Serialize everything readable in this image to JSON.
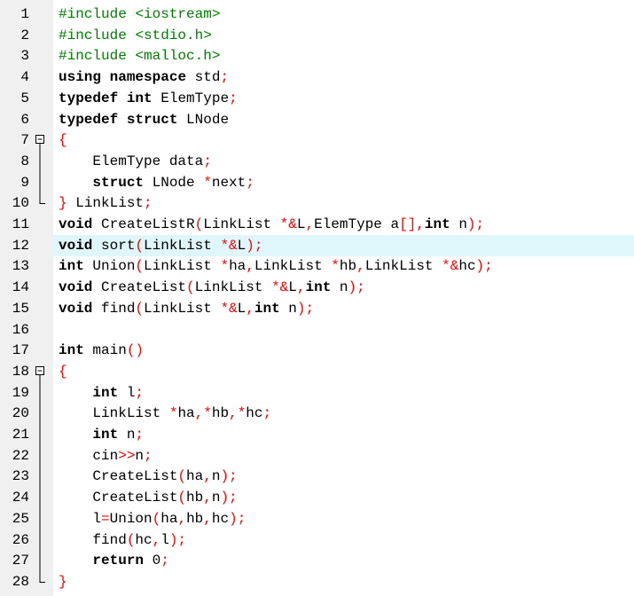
{
  "editor": {
    "highlighted_line": 12,
    "lines": [
      {
        "n": "1",
        "fold": "",
        "tokens": [
          [
            "pp",
            "#include <iostream>"
          ]
        ]
      },
      {
        "n": "2",
        "fold": "",
        "tokens": [
          [
            "pp",
            "#include <stdio.h>"
          ]
        ]
      },
      {
        "n": "3",
        "fold": "",
        "tokens": [
          [
            "pp",
            "#include <malloc.h>"
          ]
        ]
      },
      {
        "n": "4",
        "fold": "",
        "tokens": [
          [
            "kw",
            "using"
          ],
          [
            "txt",
            " "
          ],
          [
            "kw",
            "namespace"
          ],
          [
            "txt",
            " std"
          ],
          [
            "op",
            ";"
          ]
        ]
      },
      {
        "n": "5",
        "fold": "",
        "tokens": [
          [
            "kw",
            "typedef"
          ],
          [
            "txt",
            " "
          ],
          [
            "kw",
            "int"
          ],
          [
            "txt",
            " ElemType"
          ],
          [
            "op",
            ";"
          ]
        ]
      },
      {
        "n": "6",
        "fold": "",
        "tokens": [
          [
            "kw",
            "typedef"
          ],
          [
            "txt",
            " "
          ],
          [
            "kw",
            "struct"
          ],
          [
            "txt",
            " LNode"
          ]
        ]
      },
      {
        "n": "7",
        "fold": "open",
        "tokens": [
          [
            "op",
            "{"
          ]
        ]
      },
      {
        "n": "8",
        "fold": "line",
        "tokens": [
          [
            "txt",
            "    ElemType data"
          ],
          [
            "op",
            ";"
          ]
        ]
      },
      {
        "n": "9",
        "fold": "line",
        "tokens": [
          [
            "txt",
            "    "
          ],
          [
            "kw",
            "struct"
          ],
          [
            "txt",
            " LNode "
          ],
          [
            "op",
            "*"
          ],
          [
            "txt",
            "next"
          ],
          [
            "op",
            ";"
          ]
        ]
      },
      {
        "n": "10",
        "fold": "end",
        "tokens": [
          [
            "op",
            "}"
          ],
          [
            "txt",
            " LinkList"
          ],
          [
            "op",
            ";"
          ]
        ]
      },
      {
        "n": "11",
        "fold": "",
        "tokens": [
          [
            "kw",
            "void"
          ],
          [
            "txt",
            " CreateListR"
          ],
          [
            "op",
            "("
          ],
          [
            "txt",
            "LinkList "
          ],
          [
            "op",
            "*&"
          ],
          [
            "txt",
            "L"
          ],
          [
            "op",
            ","
          ],
          [
            "txt",
            "ElemType a"
          ],
          [
            "op",
            "[],"
          ],
          [
            "kw",
            "int"
          ],
          [
            "txt",
            " n"
          ],
          [
            "op",
            ");"
          ]
        ]
      },
      {
        "n": "12",
        "fold": "",
        "tokens": [
          [
            "kw",
            "void"
          ],
          [
            "txt",
            " sort"
          ],
          [
            "op",
            "("
          ],
          [
            "txt",
            "LinkList "
          ],
          [
            "op",
            "*&"
          ],
          [
            "txt",
            "L"
          ],
          [
            "op",
            ");"
          ]
        ]
      },
      {
        "n": "13",
        "fold": "",
        "tokens": [
          [
            "kw",
            "int"
          ],
          [
            "txt",
            " Union"
          ],
          [
            "op",
            "("
          ],
          [
            "txt",
            "LinkList "
          ],
          [
            "op",
            "*"
          ],
          [
            "txt",
            "ha"
          ],
          [
            "op",
            ","
          ],
          [
            "txt",
            "LinkList "
          ],
          [
            "op",
            "*"
          ],
          [
            "txt",
            "hb"
          ],
          [
            "op",
            ","
          ],
          [
            "txt",
            "LinkList "
          ],
          [
            "op",
            "*&"
          ],
          [
            "txt",
            "hc"
          ],
          [
            "op",
            ");"
          ]
        ]
      },
      {
        "n": "14",
        "fold": "",
        "tokens": [
          [
            "kw",
            "void"
          ],
          [
            "txt",
            " CreateList"
          ],
          [
            "op",
            "("
          ],
          [
            "txt",
            "LinkList "
          ],
          [
            "op",
            "*&"
          ],
          [
            "txt",
            "L"
          ],
          [
            "op",
            ","
          ],
          [
            "kw",
            "int"
          ],
          [
            "txt",
            " n"
          ],
          [
            "op",
            ");"
          ]
        ]
      },
      {
        "n": "15",
        "fold": "",
        "tokens": [
          [
            "kw",
            "void"
          ],
          [
            "txt",
            " find"
          ],
          [
            "op",
            "("
          ],
          [
            "txt",
            "LinkList "
          ],
          [
            "op",
            "*&"
          ],
          [
            "txt",
            "L"
          ],
          [
            "op",
            ","
          ],
          [
            "kw",
            "int"
          ],
          [
            "txt",
            " n"
          ],
          [
            "op",
            ");"
          ]
        ]
      },
      {
        "n": "16",
        "fold": "",
        "tokens": []
      },
      {
        "n": "17",
        "fold": "",
        "tokens": [
          [
            "kw",
            "int"
          ],
          [
            "txt",
            " main"
          ],
          [
            "op",
            "()"
          ]
        ]
      },
      {
        "n": "18",
        "fold": "open",
        "tokens": [
          [
            "op",
            "{"
          ]
        ]
      },
      {
        "n": "19",
        "fold": "line",
        "tokens": [
          [
            "txt",
            "    "
          ],
          [
            "kw",
            "int"
          ],
          [
            "txt",
            " l"
          ],
          [
            "op",
            ";"
          ]
        ]
      },
      {
        "n": "20",
        "fold": "line",
        "tokens": [
          [
            "txt",
            "    LinkList "
          ],
          [
            "op",
            "*"
          ],
          [
            "txt",
            "ha"
          ],
          [
            "op",
            ",*"
          ],
          [
            "txt",
            "hb"
          ],
          [
            "op",
            ",*"
          ],
          [
            "txt",
            "hc"
          ],
          [
            "op",
            ";"
          ]
        ]
      },
      {
        "n": "21",
        "fold": "line",
        "tokens": [
          [
            "txt",
            "    "
          ],
          [
            "kw",
            "int"
          ],
          [
            "txt",
            " n"
          ],
          [
            "op",
            ";"
          ]
        ]
      },
      {
        "n": "22",
        "fold": "line",
        "tokens": [
          [
            "txt",
            "    cin"
          ],
          [
            "op",
            ">>"
          ],
          [
            "txt",
            "n"
          ],
          [
            "op",
            ";"
          ]
        ]
      },
      {
        "n": "23",
        "fold": "line",
        "tokens": [
          [
            "txt",
            "    CreateList"
          ],
          [
            "op",
            "("
          ],
          [
            "txt",
            "ha"
          ],
          [
            "op",
            ","
          ],
          [
            "txt",
            "n"
          ],
          [
            "op",
            ");"
          ]
        ]
      },
      {
        "n": "24",
        "fold": "line",
        "tokens": [
          [
            "txt",
            "    CreateList"
          ],
          [
            "op",
            "("
          ],
          [
            "txt",
            "hb"
          ],
          [
            "op",
            ","
          ],
          [
            "txt",
            "n"
          ],
          [
            "op",
            ");"
          ]
        ]
      },
      {
        "n": "25",
        "fold": "line",
        "tokens": [
          [
            "txt",
            "    l"
          ],
          [
            "op",
            "="
          ],
          [
            "txt",
            "Union"
          ],
          [
            "op",
            "("
          ],
          [
            "txt",
            "ha"
          ],
          [
            "op",
            ","
          ],
          [
            "txt",
            "hb"
          ],
          [
            "op",
            ","
          ],
          [
            "txt",
            "hc"
          ],
          [
            "op",
            ");"
          ]
        ]
      },
      {
        "n": "26",
        "fold": "line",
        "tokens": [
          [
            "txt",
            "    find"
          ],
          [
            "op",
            "("
          ],
          [
            "txt",
            "hc"
          ],
          [
            "op",
            ","
          ],
          [
            "txt",
            "l"
          ],
          [
            "op",
            ");"
          ]
        ]
      },
      {
        "n": "27",
        "fold": "line",
        "tokens": [
          [
            "txt",
            "    "
          ],
          [
            "kw",
            "return"
          ],
          [
            "txt",
            " "
          ],
          [
            "num",
            "0"
          ],
          [
            "op",
            ";"
          ]
        ]
      },
      {
        "n": "28",
        "fold": "end",
        "tokens": [
          [
            "op",
            "}"
          ]
        ]
      }
    ]
  }
}
